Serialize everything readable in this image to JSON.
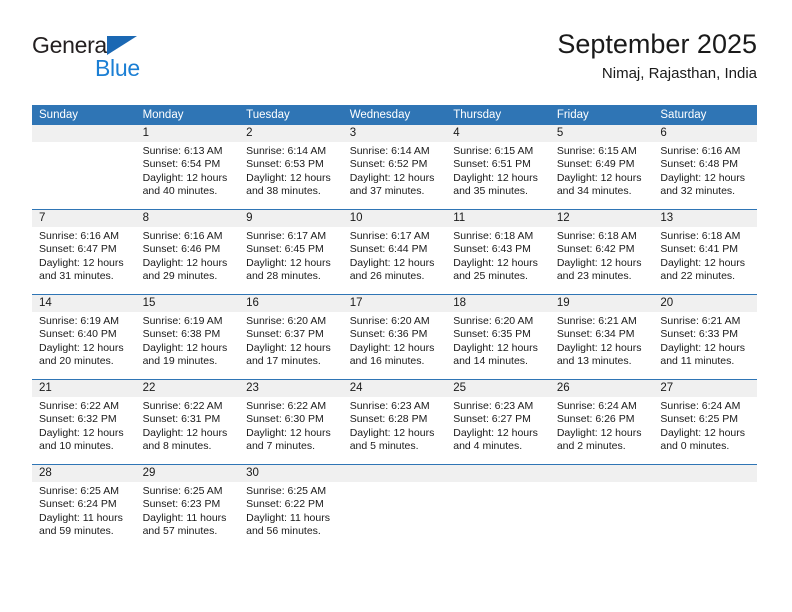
{
  "brand": {
    "name_part1": "General",
    "name_part2": "Blue",
    "logo_icon": "triangle-flag-icon",
    "accent_color": "#1b7fd4"
  },
  "header": {
    "title": "September 2025",
    "subtitle": "Nimaj, Rajasthan, India"
  },
  "theme": {
    "header_blue": "#2f75b5",
    "band_gray": "#f0f0f0"
  },
  "calendar": {
    "weekday_headers": [
      "Sunday",
      "Monday",
      "Tuesday",
      "Wednesday",
      "Thursday",
      "Friday",
      "Saturday"
    ],
    "weeks": [
      [
        {
          "day": "",
          "sunrise": "",
          "sunset": "",
          "daylight_line1": "",
          "daylight_line2": ""
        },
        {
          "day": "1",
          "sunrise": "Sunrise: 6:13 AM",
          "sunset": "Sunset: 6:54 PM",
          "daylight_line1": "Daylight: 12 hours",
          "daylight_line2": "and 40 minutes."
        },
        {
          "day": "2",
          "sunrise": "Sunrise: 6:14 AM",
          "sunset": "Sunset: 6:53 PM",
          "daylight_line1": "Daylight: 12 hours",
          "daylight_line2": "and 38 minutes."
        },
        {
          "day": "3",
          "sunrise": "Sunrise: 6:14 AM",
          "sunset": "Sunset: 6:52 PM",
          "daylight_line1": "Daylight: 12 hours",
          "daylight_line2": "and 37 minutes."
        },
        {
          "day": "4",
          "sunrise": "Sunrise: 6:15 AM",
          "sunset": "Sunset: 6:51 PM",
          "daylight_line1": "Daylight: 12 hours",
          "daylight_line2": "and 35 minutes."
        },
        {
          "day": "5",
          "sunrise": "Sunrise: 6:15 AM",
          "sunset": "Sunset: 6:49 PM",
          "daylight_line1": "Daylight: 12 hours",
          "daylight_line2": "and 34 minutes."
        },
        {
          "day": "6",
          "sunrise": "Sunrise: 6:16 AM",
          "sunset": "Sunset: 6:48 PM",
          "daylight_line1": "Daylight: 12 hours",
          "daylight_line2": "and 32 minutes."
        }
      ],
      [
        {
          "day": "7",
          "sunrise": "Sunrise: 6:16 AM",
          "sunset": "Sunset: 6:47 PM",
          "daylight_line1": "Daylight: 12 hours",
          "daylight_line2": "and 31 minutes."
        },
        {
          "day": "8",
          "sunrise": "Sunrise: 6:16 AM",
          "sunset": "Sunset: 6:46 PM",
          "daylight_line1": "Daylight: 12 hours",
          "daylight_line2": "and 29 minutes."
        },
        {
          "day": "9",
          "sunrise": "Sunrise: 6:17 AM",
          "sunset": "Sunset: 6:45 PM",
          "daylight_line1": "Daylight: 12 hours",
          "daylight_line2": "and 28 minutes."
        },
        {
          "day": "10",
          "sunrise": "Sunrise: 6:17 AM",
          "sunset": "Sunset: 6:44 PM",
          "daylight_line1": "Daylight: 12 hours",
          "daylight_line2": "and 26 minutes."
        },
        {
          "day": "11",
          "sunrise": "Sunrise: 6:18 AM",
          "sunset": "Sunset: 6:43 PM",
          "daylight_line1": "Daylight: 12 hours",
          "daylight_line2": "and 25 minutes."
        },
        {
          "day": "12",
          "sunrise": "Sunrise: 6:18 AM",
          "sunset": "Sunset: 6:42 PM",
          "daylight_line1": "Daylight: 12 hours",
          "daylight_line2": "and 23 minutes."
        },
        {
          "day": "13",
          "sunrise": "Sunrise: 6:18 AM",
          "sunset": "Sunset: 6:41 PM",
          "daylight_line1": "Daylight: 12 hours",
          "daylight_line2": "and 22 minutes."
        }
      ],
      [
        {
          "day": "14",
          "sunrise": "Sunrise: 6:19 AM",
          "sunset": "Sunset: 6:40 PM",
          "daylight_line1": "Daylight: 12 hours",
          "daylight_line2": "and 20 minutes."
        },
        {
          "day": "15",
          "sunrise": "Sunrise: 6:19 AM",
          "sunset": "Sunset: 6:38 PM",
          "daylight_line1": "Daylight: 12 hours",
          "daylight_line2": "and 19 minutes."
        },
        {
          "day": "16",
          "sunrise": "Sunrise: 6:20 AM",
          "sunset": "Sunset: 6:37 PM",
          "daylight_line1": "Daylight: 12 hours",
          "daylight_line2": "and 17 minutes."
        },
        {
          "day": "17",
          "sunrise": "Sunrise: 6:20 AM",
          "sunset": "Sunset: 6:36 PM",
          "daylight_line1": "Daylight: 12 hours",
          "daylight_line2": "and 16 minutes."
        },
        {
          "day": "18",
          "sunrise": "Sunrise: 6:20 AM",
          "sunset": "Sunset: 6:35 PM",
          "daylight_line1": "Daylight: 12 hours",
          "daylight_line2": "and 14 minutes."
        },
        {
          "day": "19",
          "sunrise": "Sunrise: 6:21 AM",
          "sunset": "Sunset: 6:34 PM",
          "daylight_line1": "Daylight: 12 hours",
          "daylight_line2": "and 13 minutes."
        },
        {
          "day": "20",
          "sunrise": "Sunrise: 6:21 AM",
          "sunset": "Sunset: 6:33 PM",
          "daylight_line1": "Daylight: 12 hours",
          "daylight_line2": "and 11 minutes."
        }
      ],
      [
        {
          "day": "21",
          "sunrise": "Sunrise: 6:22 AM",
          "sunset": "Sunset: 6:32 PM",
          "daylight_line1": "Daylight: 12 hours",
          "daylight_line2": "and 10 minutes."
        },
        {
          "day": "22",
          "sunrise": "Sunrise: 6:22 AM",
          "sunset": "Sunset: 6:31 PM",
          "daylight_line1": "Daylight: 12 hours",
          "daylight_line2": "and 8 minutes."
        },
        {
          "day": "23",
          "sunrise": "Sunrise: 6:22 AM",
          "sunset": "Sunset: 6:30 PM",
          "daylight_line1": "Daylight: 12 hours",
          "daylight_line2": "and 7 minutes."
        },
        {
          "day": "24",
          "sunrise": "Sunrise: 6:23 AM",
          "sunset": "Sunset: 6:28 PM",
          "daylight_line1": "Daylight: 12 hours",
          "daylight_line2": "and 5 minutes."
        },
        {
          "day": "25",
          "sunrise": "Sunrise: 6:23 AM",
          "sunset": "Sunset: 6:27 PM",
          "daylight_line1": "Daylight: 12 hours",
          "daylight_line2": "and 4 minutes."
        },
        {
          "day": "26",
          "sunrise": "Sunrise: 6:24 AM",
          "sunset": "Sunset: 6:26 PM",
          "daylight_line1": "Daylight: 12 hours",
          "daylight_line2": "and 2 minutes."
        },
        {
          "day": "27",
          "sunrise": "Sunrise: 6:24 AM",
          "sunset": "Sunset: 6:25 PM",
          "daylight_line1": "Daylight: 12 hours",
          "daylight_line2": "and 0 minutes."
        }
      ],
      [
        {
          "day": "28",
          "sunrise": "Sunrise: 6:25 AM",
          "sunset": "Sunset: 6:24 PM",
          "daylight_line1": "Daylight: 11 hours",
          "daylight_line2": "and 59 minutes."
        },
        {
          "day": "29",
          "sunrise": "Sunrise: 6:25 AM",
          "sunset": "Sunset: 6:23 PM",
          "daylight_line1": "Daylight: 11 hours",
          "daylight_line2": "and 57 minutes."
        },
        {
          "day": "30",
          "sunrise": "Sunrise: 6:25 AM",
          "sunset": "Sunset: 6:22 PM",
          "daylight_line1": "Daylight: 11 hours",
          "daylight_line2": "and 56 minutes."
        },
        {
          "day": "",
          "sunrise": "",
          "sunset": "",
          "daylight_line1": "",
          "daylight_line2": ""
        },
        {
          "day": "",
          "sunrise": "",
          "sunset": "",
          "daylight_line1": "",
          "daylight_line2": ""
        },
        {
          "day": "",
          "sunrise": "",
          "sunset": "",
          "daylight_line1": "",
          "daylight_line2": ""
        },
        {
          "day": "",
          "sunrise": "",
          "sunset": "",
          "daylight_line1": "",
          "daylight_line2": ""
        }
      ]
    ]
  }
}
